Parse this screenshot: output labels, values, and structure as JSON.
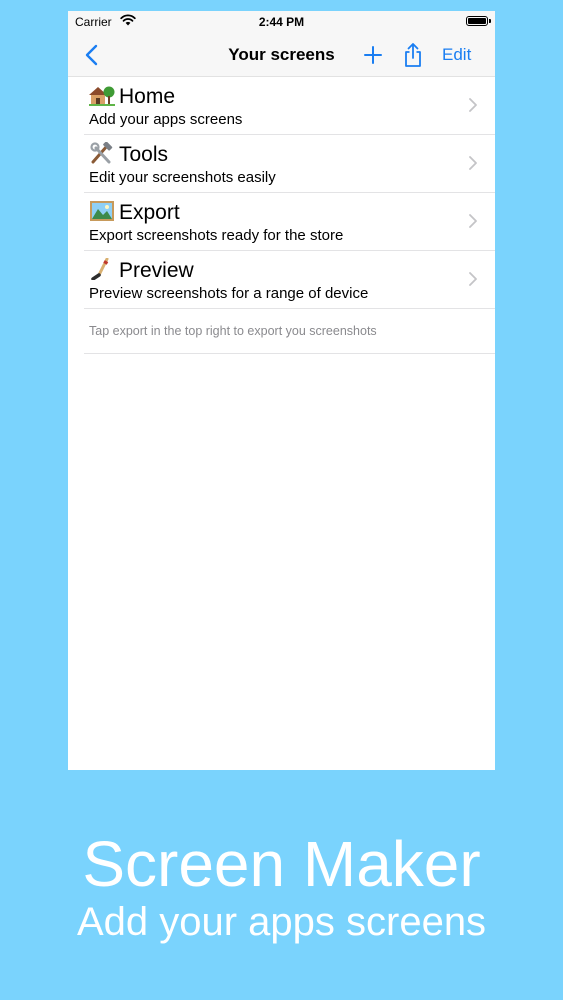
{
  "status_bar": {
    "carrier": "Carrier",
    "time": "2:44 PM"
  },
  "nav": {
    "title": "Your screens",
    "edit_label": "Edit"
  },
  "rows": [
    {
      "icon": "house-with-garden-icon",
      "title": "Home",
      "subtitle": "Add your apps screens"
    },
    {
      "icon": "hammer-and-wrench-icon",
      "title": "Tools",
      "subtitle": "Edit your screenshots easily"
    },
    {
      "icon": "landscape-picture-icon",
      "title": "Export",
      "subtitle": "Export screenshots ready for the store"
    },
    {
      "icon": "hockey-stick-icon",
      "title": "Preview",
      "subtitle": "Preview screenshots for a range of device"
    }
  ],
  "footer_note": "Tap export in the top right to export you screenshots",
  "promo": {
    "title": "Screen Maker",
    "subtitle": "Add your apps screens"
  },
  "colors": {
    "background": "#7ad3fd",
    "tint": "#1a7ef2"
  }
}
